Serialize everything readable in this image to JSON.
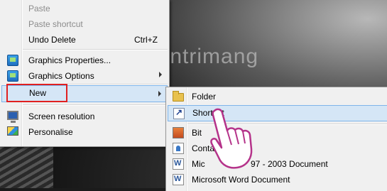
{
  "context_menu": {
    "items": [
      {
        "label": "Paste",
        "disabled": true
      },
      {
        "label": "Paste shortcut",
        "disabled": true
      },
      {
        "label": "Undo Delete",
        "accelerator": "Ctrl+Z"
      },
      {
        "label": "Graphics Properties...",
        "icon": "graphics-properties-icon"
      },
      {
        "label": "Graphics Options",
        "icon": "graphics-options-icon",
        "has_submenu": true
      },
      {
        "label": "New",
        "has_submenu": true,
        "highlighted": true
      },
      {
        "label": "Screen resolution",
        "icon": "monitor-icon"
      },
      {
        "label": "Personalise",
        "icon": "personalise-icon"
      }
    ]
  },
  "new_submenu": {
    "items": [
      {
        "label": "Folder",
        "icon": "folder-icon"
      },
      {
        "label": "Shortcut",
        "icon": "shortcut-icon",
        "highlighted": true
      },
      {
        "label": "Bit",
        "icon": "bitmap-icon"
      },
      {
        "label": "Contac",
        "icon": "contact-icon"
      },
      {
        "label": "Mic",
        "label_right": "97 - 2003 Document",
        "icon": "word-doc-icon"
      },
      {
        "label": "Microsoft Word Document",
        "icon": "word-doc-icon"
      }
    ]
  },
  "watermark": {
    "text": "uantrimang"
  },
  "colors": {
    "highlight_bg": "#d5e6f6",
    "highlight_border": "#7eb4ea",
    "annotation_red": "#e02020"
  }
}
